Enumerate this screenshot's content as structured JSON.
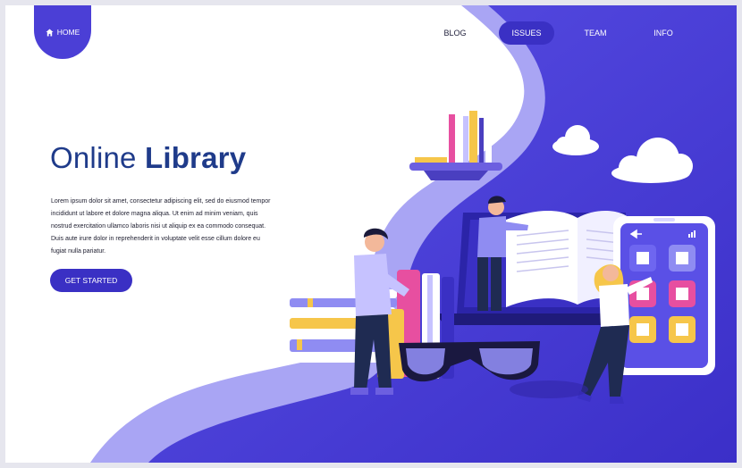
{
  "nav": {
    "home_label": "HOME",
    "items": [
      {
        "label": "BLOG"
      },
      {
        "label": "ISSUES"
      },
      {
        "label": "TEAM"
      },
      {
        "label": "INFO"
      }
    ],
    "active_item": "ISSUES"
  },
  "hero": {
    "title_light": "Online",
    "title_bold": "Library",
    "body": "Lorem ipsum dolor sit amet, consectetur adipiscing elit, sed do eiusmod tempor incididunt ut labore et dolore magna aliqua. Ut enim ad minim veniam, quis nostrud exercitation ullamco laboris nisi ut aliquip ex ea commodo consequat. Duis aute irure dolor in reprehenderit in voluptate velit esse cillum dolore eu fugiat nulla pariatur.",
    "cta_label": "GET STARTED"
  },
  "icons": {
    "home": "home-icon",
    "phone_back": "arrow-left-icon",
    "phone_signal": "signal-icon"
  },
  "colors": {
    "brand": "#4b3fd6",
    "brand_dark": "#3a30c4",
    "light_purple": "#a7a3f3",
    "title": "#1f3b8a"
  }
}
